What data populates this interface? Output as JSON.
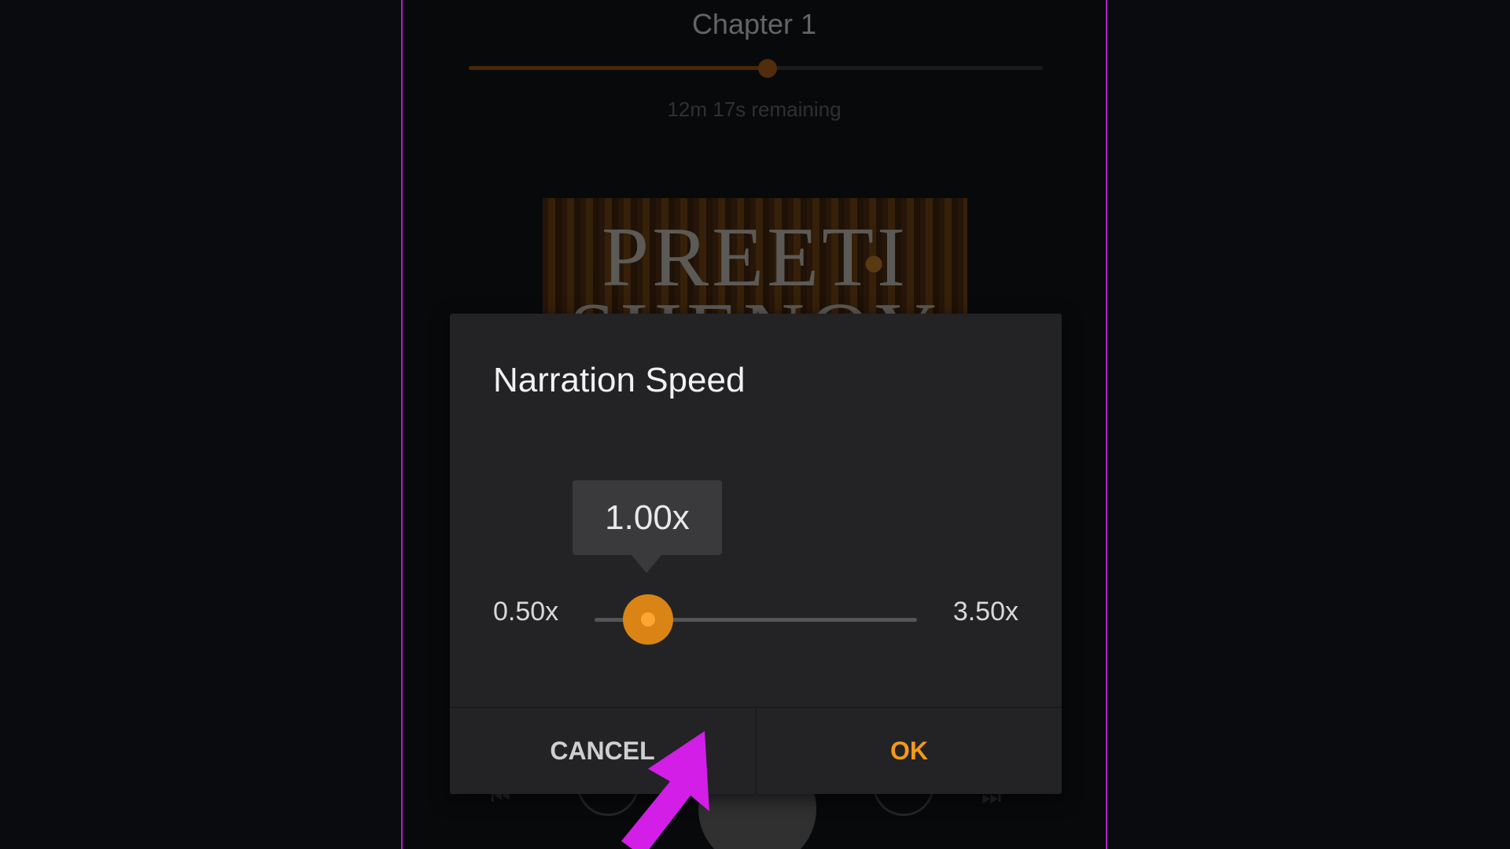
{
  "player": {
    "chapter_title": "Chapter 1",
    "progress_fraction": 0.52,
    "remaining": "12m 17s remaining",
    "cover_title_line1": "PREETI",
    "cover_title_line2": "SHENOY"
  },
  "dialog": {
    "title": "Narration Speed",
    "current_value": "1.00x",
    "min_label": "0.50x",
    "max_label": "3.50x",
    "min_value": 0.5,
    "max_value": 3.5,
    "value": 1.0,
    "cancel_label": "CANCEL",
    "ok_label": "OK"
  },
  "colors": {
    "accent": "#f59a16",
    "annotation_arrow": "#d21ee6"
  },
  "icons": {
    "annotation": "pointer-arrow-icon"
  }
}
